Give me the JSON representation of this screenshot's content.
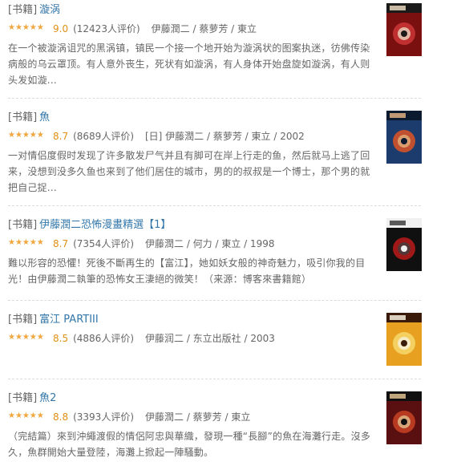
{
  "results": [
    {
      "category": "[书籍]",
      "title": "漩涡",
      "rating": 4.5,
      "score": "9.0",
      "votes": "(12423人评价)",
      "meta": "伊藤潤二 / 蔡萝芳 / 東立",
      "description": "在一个被漩涡诅咒的黑涡镇，镇民一个接一个地开始为漩涡状的图案执迷，彷佛传染病般的乌云罩顶。有人意外丧生，死状有如漩涡，有人身体开始盘旋如漩涡，有人则头发如漩...",
      "cover": {
        "name": "uzumaki-cover",
        "colors": [
          "#7a1010",
          "#c03030",
          "#1a1a1a",
          "#e8d8c0"
        ]
      }
    },
    {
      "category": "[书籍]",
      "title": "魚",
      "rating": 4.5,
      "score": "8.7",
      "votes": "(8689人评价)",
      "meta": "[日] 伊藤潤二 / 蔡萝芳 / 東立 / 2002",
      "description": "一对情侣度假时发现了许多散发尸气并且有脚可在岸上行走的鱼，然后就马上逃了回来，没想到没多久鱼也来到了他们居住的城市，男的的叔叔是一个博士，那个男的就把自己捉...",
      "cover": {
        "name": "gyo-cover",
        "colors": [
          "#1c3c6e",
          "#c05030",
          "#0c1a30",
          "#e0b080"
        ]
      }
    },
    {
      "category": "[书籍]",
      "title": "伊藤潤二恐怖漫畫精選【1】",
      "rating": 4.5,
      "score": "8.7",
      "votes": "(7354人评价)",
      "meta": "伊藤潤二 / 何力 / 東立 / 1998",
      "description": "難以形容的恐懼！死後不斷再生的【富江】，她如妖女般的神奇魅力，吸引你我的目光！由伊藤潤二執筆的恐怖女王淒絕的微笑！（来源：博客來書籍館）",
      "cover": {
        "name": "horror-collection-cover",
        "colors": [
          "#101010",
          "#a01818",
          "#f0f0f0",
          "#404040"
        ]
      }
    },
    {
      "category": "[书籍]",
      "title": "富江 PARTIII",
      "rating": 4.5,
      "score": "8.5",
      "votes": "(4886人评价)",
      "meta": "伊藤润二 / 东立出版社 / 2003",
      "description": "",
      "cover": {
        "name": "tomie-cover",
        "colors": [
          "#e8a020",
          "#f4d060",
          "#3a1a0a",
          "#f8f0e0"
        ]
      }
    },
    {
      "category": "[书籍]",
      "title": "魚2",
      "rating": 4.5,
      "score": "8.8",
      "votes": "(3393人评价)",
      "meta": "伊藤潤二 / 蔡萝芳 / 東立",
      "description": "（完結篇）來到沖繩渡假的情侶阿忠與華織，發現一種“長腳”的魚在海灘行走。沒多久，魚群開始大量登陸，海灘上掀起一陣騷動。",
      "cover": {
        "name": "gyo2-cover",
        "colors": [
          "#5a1010",
          "#b83a20",
          "#101010",
          "#e0c090"
        ]
      }
    }
  ]
}
